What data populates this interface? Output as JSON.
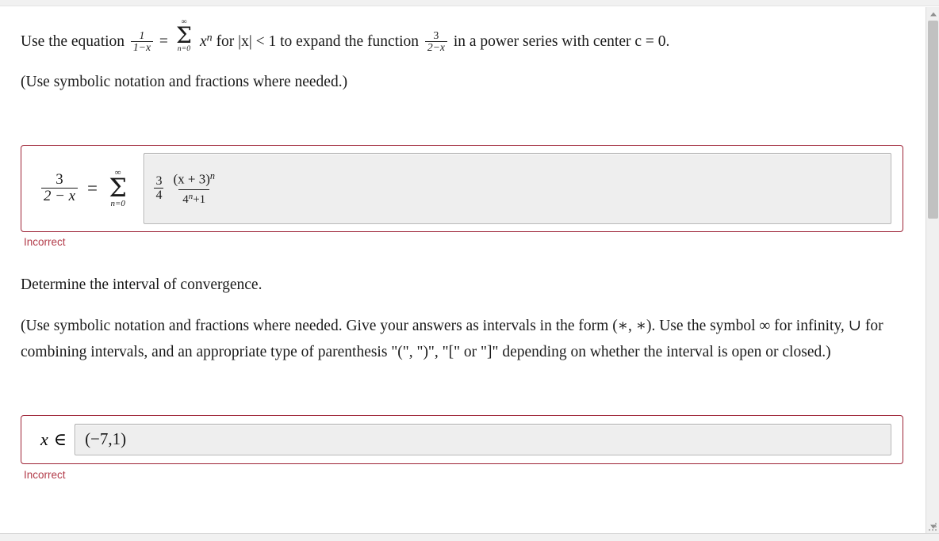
{
  "question": {
    "prompt_line": {
      "lead": "Use the equation",
      "frac1_num": "1",
      "frac1_den": "1−x",
      "equals": "=",
      "sum_top": "∞",
      "sum_sigma": "Σ",
      "sum_bottom": "n=0",
      "term": "x",
      "term_exp": "n",
      "mid": "for |x| < 1 to expand the function",
      "frac2_num": "3",
      "frac2_den": "2−x",
      "tail": "in a power series with center c = 0."
    },
    "instruction_1": "(Use symbolic notation and fractions where needed.)",
    "instruction_2": "Determine the interval of convergence.",
    "instruction_3": "(Use symbolic notation and fractions where needed. Give your answers as intervals in the form (∗, ∗). Use the symbol ∞ for infinity, ∪ for combining intervals, and an appropriate type of parenthesis \"(\", \")\", \"[\" or \"]\" depending on whether the interval is open or closed.)"
  },
  "answer_series": {
    "lhs_num": "3",
    "lhs_den": "2 − x",
    "equals": "=",
    "sum_top": "∞",
    "sum_sigma": "Σ",
    "sum_bottom": "n=0",
    "input_value": {
      "coef_num": "3",
      "coef_den": "4",
      "frac_num": "(x + 3)",
      "frac_num_exp": "n",
      "frac_den_base": "4",
      "frac_den_exp": "n",
      "frac_den_tail": "+1"
    },
    "status": "Incorrect"
  },
  "answer_interval": {
    "lhs_var": "x",
    "lhs_member": "∈",
    "input_value": "(−7,1)",
    "status": "Incorrect"
  },
  "colors": {
    "card_border": "#9d2235",
    "status_text": "#b23a48",
    "field_bg": "#eeeeee",
    "field_border": "#b9b9b9",
    "page_bg": "#ffffff",
    "chrome_bg": "#f1f1f1",
    "scrollbar_thumb": "#c1c1c1"
  },
  "scrollbar": {
    "up_arrow": "scroll-up-arrow",
    "down_arrow": "scroll-down-arrow",
    "thumb": "scroll-thumb",
    "resize_grip": "resize-grip"
  }
}
